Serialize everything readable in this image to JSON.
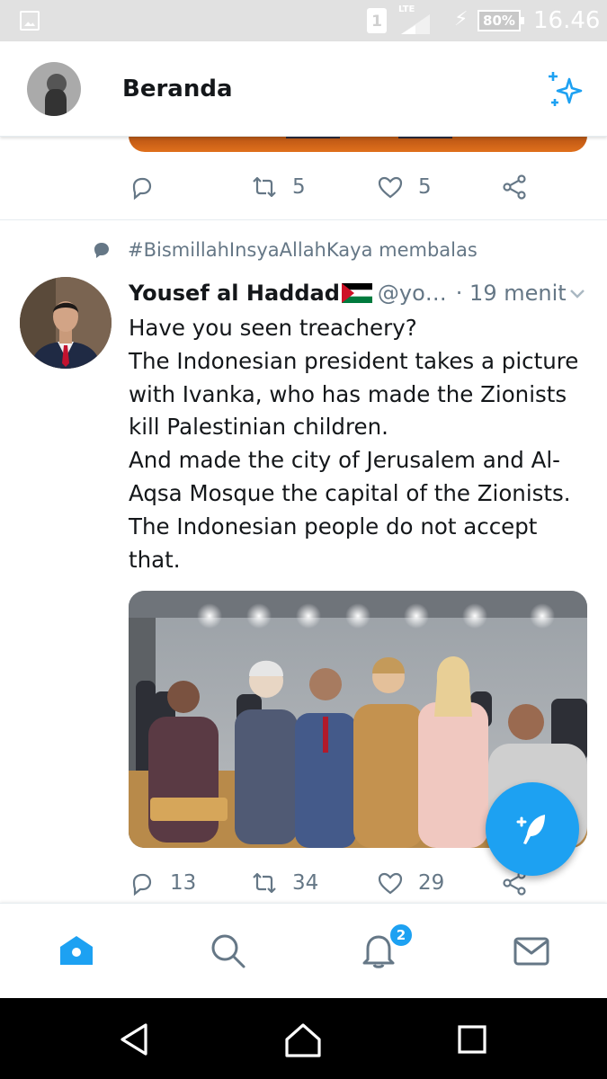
{
  "status_bar": {
    "sim_label": "1",
    "network": "LTE",
    "battery": "80%",
    "time": "16.46"
  },
  "header": {
    "title": "Beranda"
  },
  "previous_tweet": {
    "actions": {
      "replies": "",
      "retweets": "5",
      "likes": "5"
    }
  },
  "tweet": {
    "reply_context": "#BismillahInsyaAllahKaya membalas",
    "author_name": "Yousef al Haddad",
    "handle": "@yo…",
    "time": "· 19 menit",
    "text_lines": [
      "Have you seen treachery?",
      "The Indonesian president takes a picture",
      "with Ivanka, who has made the Zionists",
      "kill Palestinian children.",
      "And made the city of Jerusalem and Al-",
      "Aqsa Mosque the capital of the Zionists.",
      "The Indonesian people do not accept",
      "that."
    ],
    "actions": {
      "replies": "13",
      "retweets": "34",
      "likes": "29"
    }
  },
  "tab_bar": {
    "notifications_badge": "2"
  },
  "colors": {
    "accent": "#1da1f2",
    "secondary_text": "#657786",
    "primary_text": "#14171a"
  },
  "icons": [
    "gallery-icon",
    "sparkle-icon",
    "reply-icon",
    "retweet-icon",
    "like-icon",
    "share-icon",
    "chevron-down-icon",
    "compose-icon",
    "home-icon",
    "search-icon",
    "notifications-icon",
    "messages-icon",
    "back-icon",
    "home-nav-icon",
    "recents-icon"
  ]
}
